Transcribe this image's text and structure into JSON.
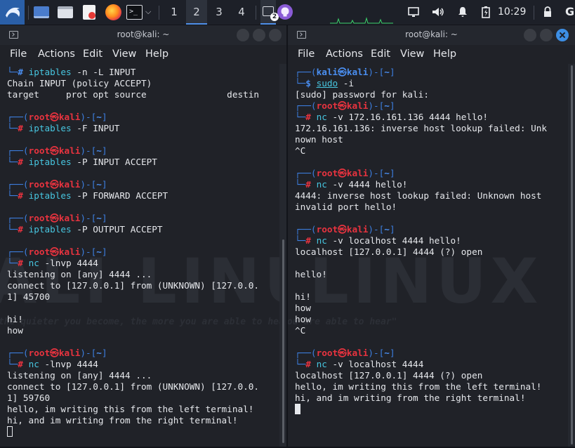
{
  "taskbar": {
    "workspaces": [
      "1",
      "2",
      "3",
      "4"
    ],
    "active_workspace": "2",
    "terminal_badge": "2",
    "clock": "10:29",
    "icons": [
      "kali-menu-icon",
      "desktop-icon",
      "folder-icon",
      "text-editor-icon",
      "firefox-icon",
      "terminal-icon",
      "chevron-down-icon",
      "terminal-task-icon",
      "github-icon",
      "display-icon",
      "volume-icon",
      "notifications-icon",
      "battery-icon",
      "lock-icon",
      "google-icon"
    ],
    "google_letter": "G"
  },
  "colors": {
    "prompt_red": "#e8333f",
    "prompt_blue": "#3d7fe0",
    "command_cyan": "#47c6e0",
    "accent": "#3d8fe5"
  },
  "left": {
    "title": "root@kali: ~",
    "menu": [
      "File",
      "Actions",
      "Edit",
      "View",
      "Help"
    ],
    "watermark": "KALI LINUX",
    "watermark_tag": "\"the quieter you become, the more you are able to hear\"",
    "partial_cmd": {
      "pre": "└─",
      "hash": "#",
      "cmd": "iptables",
      "args": " -n -L INPUT"
    },
    "out1": [
      "Chain INPUT (policy ACCEPT)",
      "target     prot opt source               destin"
    ],
    "prompts": [
      {
        "open": "┌──(",
        "user": "root",
        "at": "㉿",
        "host": "kali",
        "mid": ")-[",
        "dir": "~",
        "close": "]",
        "pre": "└─",
        "hash": "#",
        "cmd": "iptables",
        "args": " -F INPUT"
      },
      {
        "open": "┌──(",
        "user": "root",
        "at": "㉿",
        "host": "kali",
        "mid": ")-[",
        "dir": "~",
        "close": "]",
        "pre": "└─",
        "hash": "#",
        "cmd": "iptables",
        "args": " -P INPUT ACCEPT"
      },
      {
        "open": "┌──(",
        "user": "root",
        "at": "㉿",
        "host": "kali",
        "mid": ")-[",
        "dir": "~",
        "close": "]",
        "pre": "└─",
        "hash": "#",
        "cmd": "iptables",
        "args": " -P FORWARD ACCEPT"
      },
      {
        "open": "┌──(",
        "user": "root",
        "at": "㉿",
        "host": "kali",
        "mid": ")-[",
        "dir": "~",
        "close": "]",
        "pre": "└─",
        "hash": "#",
        "cmd": "iptables",
        "args": " -P OUTPUT ACCEPT"
      },
      {
        "open": "┌──(",
        "user": "root",
        "at": "㉿",
        "host": "kali",
        "mid": ")-[",
        "dir": "~",
        "close": "]",
        "pre": "└─",
        "hash": "#",
        "cmd": "nc",
        "args": " -lnvp 4444"
      },
      {
        "open": "┌──(",
        "user": "root",
        "at": "㉿",
        "host": "kali",
        "mid": ")-[",
        "dir": "~",
        "close": "]",
        "pre": "└─",
        "hash": "#",
        "cmd": "nc",
        "args": " -lnvp 4444"
      }
    ],
    "out_a": [
      "listening on [any] 4444 ...",
      "connect to [127.0.0.1] from (UNKNOWN) [127.0.0.",
      "1] 45700",
      "",
      "hi!",
      "how"
    ],
    "out_b": [
      "listening on [any] 4444 ...",
      "connect to [127.0.0.1] from (UNKNOWN) [127.0.0.",
      "1] 59760",
      "hello, im writing this from the left terminal!",
      "hi, and im writing from the right terminal!"
    ]
  },
  "right": {
    "title": "root@kali: ~",
    "menu": [
      "File",
      "Actions",
      "Edit",
      "View",
      "Help"
    ],
    "user_prompt": {
      "open": "┌──(",
      "user": "kali",
      "at": "㉿",
      "host": "kali",
      "mid": ")-[",
      "dir": "~",
      "close": "]",
      "pre": "└─",
      "dollar": "$",
      "cmd": "sudo",
      "args": " -i"
    },
    "sudo_msg": "[sudo] password for kali:",
    "prompts": [
      {
        "open": "┌──(",
        "user": "root",
        "at": "㉿",
        "host": "kali",
        "mid": ")-[",
        "dir": "~",
        "close": "]",
        "pre": "└─",
        "hash": "#",
        "cmd": "nc",
        "args": " -v 172.16.161.136 4444 hello!"
      },
      {
        "open": "┌──(",
        "user": "root",
        "at": "㉿",
        "host": "kali",
        "mid": ")-[",
        "dir": "~",
        "close": "]",
        "pre": "└─",
        "hash": "#",
        "cmd": "nc",
        "args": " -v 4444 hello!"
      },
      {
        "open": "┌──(",
        "user": "root",
        "at": "㉿",
        "host": "kali",
        "mid": ")-[",
        "dir": "~",
        "close": "]",
        "pre": "└─",
        "hash": "#",
        "cmd": "nc",
        "args": " -v localhost 4444 hello!"
      },
      {
        "open": "┌──(",
        "user": "root",
        "at": "㉿",
        "host": "kali",
        "mid": ")-[",
        "dir": "~",
        "close": "]",
        "pre": "└─",
        "hash": "#",
        "cmd": "nc",
        "args": " -v localhost 4444"
      }
    ],
    "out_a": [
      "172.16.161.136: inverse host lookup failed: Unk",
      "nown host",
      "^C"
    ],
    "out_b": [
      "4444: inverse host lookup failed: Unknown host",
      "invalid port hello!"
    ],
    "out_c": [
      "localhost [127.0.0.1] 4444 (?) open",
      "",
      "hello!",
      "",
      "hi!",
      "how",
      "how",
      "^C"
    ],
    "out_d": [
      "localhost [127.0.0.1] 4444 (?) open",
      "hello, im writing this from the left terminal!",
      "hi, and im writing from the right terminal!"
    ]
  }
}
